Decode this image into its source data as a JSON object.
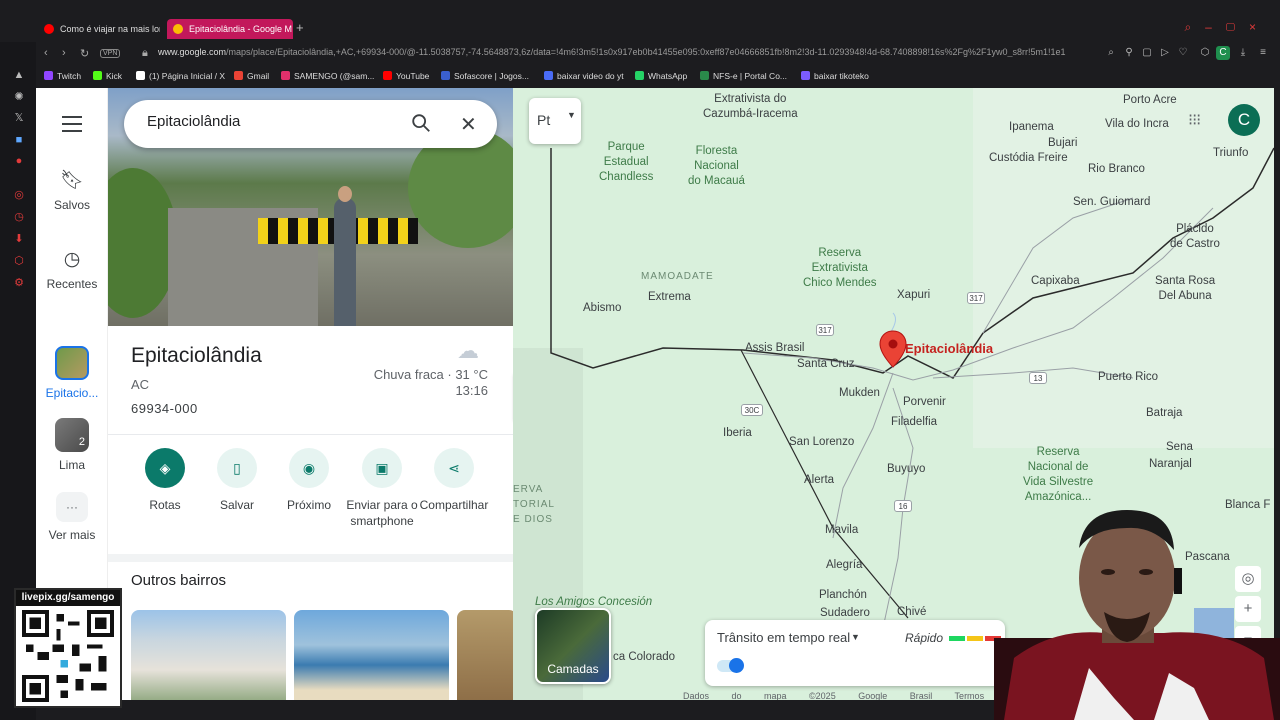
{
  "browser": {
    "tabs": [
      {
        "label": "Como é viajar na mais lon"
      },
      {
        "label": "Epitaciolândia - Google M"
      }
    ],
    "url_host": "www.google.com",
    "url_path": "/maps/place/Epitaciolândia,+AC,+69934-000/@-11.5038757,-74.5648873,6z/data=!4m6!3m5!1s0x917eb0b41455e095:0xeff87e04666851fb!8m2!3d-11.0293948!4d-68.7408898!16s%2Fg%2F1yw0_s8rr!5m1!1e1",
    "bookmarks": [
      "Twitch",
      "Kick",
      "(1) Página Inicial / X",
      "Gmail",
      "SAMENGO (@sam...",
      "YouTube",
      "Sofascore | Jogos...",
      "baixar video do yt",
      "WhatsApp",
      "NFS-e | Portal Co...",
      "baixar tikoteko"
    ],
    "bookmark_colors": [
      "#9146ff",
      "#53fc18",
      "#ffffff",
      "#ea4335",
      "#e1306c",
      "#ff0000",
      "#3a5fcd",
      "#4a6cf7",
      "#25d366",
      "#2a8a4a",
      "#7b5cff"
    ]
  },
  "rail": {
    "saved_label": "Salvos",
    "recent_label": "Recentes",
    "recent_place_label": "Epitacio...",
    "lima_label": "Lima",
    "lima_badge": "2",
    "more_label": "Ver mais"
  },
  "search": {
    "value": "Epitaciolândia"
  },
  "place": {
    "name": "Epitaciolândia",
    "state": "AC",
    "cep": "69934-000",
    "weather_desc": "Chuva fraca · 31 °C",
    "time": "13:16"
  },
  "actions": [
    {
      "label": "Rotas"
    },
    {
      "label": "Salvar"
    },
    {
      "label": "Próximo"
    },
    {
      "label": "Enviar para o smartphone"
    },
    {
      "label": "Compartilhar"
    }
  ],
  "section_title": "Outros bairros",
  "map": {
    "lang_button": "Pt",
    "account_initial": "C",
    "labels": {
      "cazumba": "Extrativista do\nCazumbá-Iracema",
      "parque": "Parque\nEstadual\nChandless",
      "floresta": "Floresta\nNacional\ndo Macauá",
      "mamoadate": "MAMOADATE",
      "abismo": "Abismo",
      "extrema": "Extrema",
      "reserva_chico": "Reserva\nExtrativista\nChico Mendes",
      "xapuri": "Xapuri",
      "assis": "Assis Brasil",
      "santacruz": "Santa Cruz",
      "epitaciolandia": "Epitaciolândia",
      "mukden": "Mukden",
      "porvenir": "Porvenir",
      "filadelfia": "Filadelfia",
      "iberia": "Iberia",
      "sanlorenzo": "San Lorenzo",
      "buyuyo": "Buyuyo",
      "alerta": "Alerta",
      "mavila": "Mavila",
      "alegria": "Alegría",
      "planchon": "Planchón",
      "sudadero": "Sudadero",
      "chivé": "Chivé",
      "amigos": "Los Amigos Concesión",
      "colorado": "ca Colorado",
      "reserva_area": "ERVA\nTORIAL\nE DIOS",
      "porto_acre": "Porto Acre",
      "ipanema": "Ipanema",
      "vila_incra": "Vila do Incra",
      "bujari": "Bujari",
      "custodia": "Custódia Freire",
      "rio_branco": "Rio Branco",
      "triunfo": "Triunfo",
      "guiomard": "Sen. Guiomard",
      "placido": "Plácido\nde Castro",
      "capixaba": "Capixaba",
      "santarosa": "Santa Rosa\nDel Abuna",
      "puerto_rico": "Puerto Rico",
      "batraja": "Batraja",
      "sena": "Sena",
      "naranjal": "Naranjal",
      "reserva_manuripi": "Reserva\nNacional de\nVida Silvestre\nAmazónica...",
      "blanca": "Blanca F",
      "pascana": "Pascana"
    },
    "shields": [
      "317",
      "317",
      "13",
      "30C",
      "16"
    ],
    "layers_label": "Camadas",
    "traffic_label": "Trânsito em tempo real",
    "traffic_fast": "Rápido",
    "traffic_colors": [
      "#1ed760",
      "#f5c518",
      "#e53935",
      "#9c1c1c"
    ],
    "footer": "Dados do mapa ©2025 Google   Brasil   Termos   Privacidade   En"
  },
  "overlay": {
    "qr_link": "livepix.gg/samengo"
  }
}
